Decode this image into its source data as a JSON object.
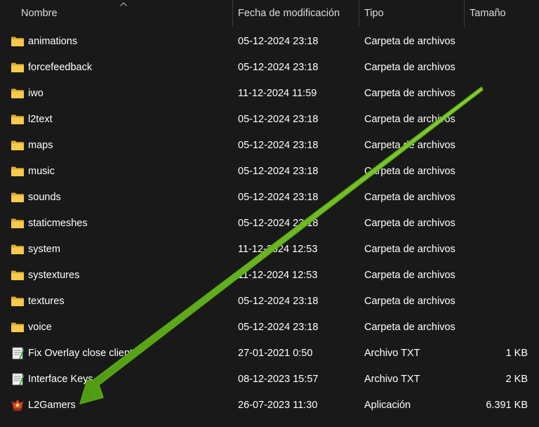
{
  "columns": {
    "name": "Nombre",
    "date": "Fecha de modificación",
    "type": "Tipo",
    "size": "Tamaño"
  },
  "files": [
    {
      "name": "animations",
      "date": "05-12-2024 23:18",
      "type": "Carpeta de archivos",
      "size": "",
      "icon": "folder-icon"
    },
    {
      "name": "forcefeedback",
      "date": "05-12-2024 23:18",
      "type": "Carpeta de archivos",
      "size": "",
      "icon": "folder-icon"
    },
    {
      "name": "iwo",
      "date": "11-12-2024 11:59",
      "type": "Carpeta de archivos",
      "size": "",
      "icon": "folder-icon"
    },
    {
      "name": "l2text",
      "date": "05-12-2024 23:18",
      "type": "Carpeta de archivos",
      "size": "",
      "icon": "folder-icon"
    },
    {
      "name": "maps",
      "date": "05-12-2024 23:18",
      "type": "Carpeta de archivos",
      "size": "",
      "icon": "folder-icon"
    },
    {
      "name": "music",
      "date": "05-12-2024 23:18",
      "type": "Carpeta de archivos",
      "size": "",
      "icon": "folder-icon"
    },
    {
      "name": "sounds",
      "date": "05-12-2024 23:18",
      "type": "Carpeta de archivos",
      "size": "",
      "icon": "folder-icon"
    },
    {
      "name": "staticmeshes",
      "date": "05-12-2024 23:18",
      "type": "Carpeta de archivos",
      "size": "",
      "icon": "folder-icon"
    },
    {
      "name": "system",
      "date": "11-12-2024 12:53",
      "type": "Carpeta de archivos",
      "size": "",
      "icon": "folder-icon"
    },
    {
      "name": "systextures",
      "date": "11-12-2024 12:53",
      "type": "Carpeta de archivos",
      "size": "",
      "icon": "folder-icon"
    },
    {
      "name": "textures",
      "date": "05-12-2024 23:18",
      "type": "Carpeta de archivos",
      "size": "",
      "icon": "folder-icon"
    },
    {
      "name": "voice",
      "date": "05-12-2024 23:18",
      "type": "Carpeta de archivos",
      "size": "",
      "icon": "folder-icon"
    },
    {
      "name": "Fix Overlay close client",
      "date": "27-01-2021 0:50",
      "type": "Archivo TXT",
      "size": "1 KB",
      "icon": "text-file-icon"
    },
    {
      "name": "Interface Keys",
      "date": "08-12-2023 15:57",
      "type": "Archivo TXT",
      "size": "2 KB",
      "icon": "text-file-icon"
    },
    {
      "name": "L2Gamers",
      "date": "26-07-2023 11:30",
      "type": "Aplicación",
      "size": "6.391 KB",
      "icon": "application-icon"
    }
  ],
  "colors": {
    "background": "#191919",
    "text": "#ffffff",
    "header_text": "#dcdcdc",
    "folder": "#f6c343",
    "arrow": "#6fbf1a"
  },
  "annotation": {
    "icon": "green-arrow-icon"
  }
}
